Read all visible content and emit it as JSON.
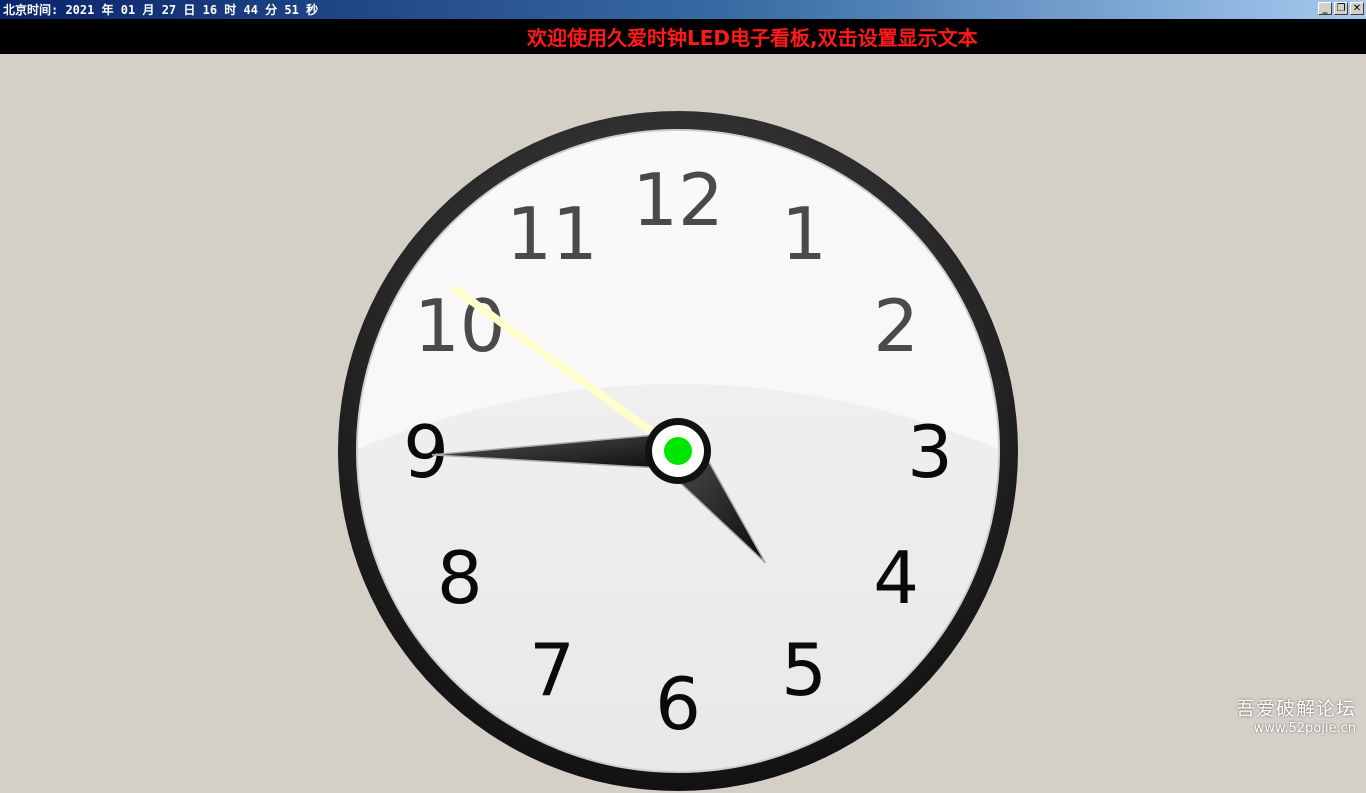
{
  "window": {
    "title": "北京时间: 2021 年 01 月 27 日 16 时 44 分 51 秒",
    "controls": {
      "minimize": "_",
      "restore": "❐",
      "close": "✕"
    }
  },
  "banner": {
    "text": "欢迎使用久爱时钟LED电子看板,双击设置显示文本",
    "color": "#ff1a1a",
    "background": "#000000"
  },
  "clock": {
    "hour": 16,
    "minute": 44,
    "second": 51,
    "numerals": [
      "12",
      "1",
      "2",
      "3",
      "4",
      "5",
      "6",
      "7",
      "8",
      "9",
      "10",
      "11"
    ],
    "center_dot_color": "#00e600",
    "second_hand_color": "#ffffcc"
  },
  "watermark": {
    "line1": "吾爱破解论坛",
    "line2": "www.52pojie.cn"
  }
}
